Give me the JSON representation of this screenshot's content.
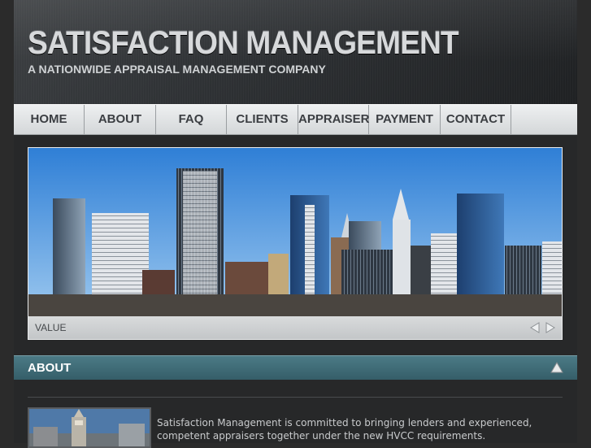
{
  "header": {
    "title": "SATISFACTION MANAGEMENT",
    "tagline": "A NATIONWIDE APPRAISAL MANAGEMENT COMPANY"
  },
  "nav": {
    "items": [
      {
        "label": "HOME"
      },
      {
        "label": "ABOUT"
      },
      {
        "label": "FAQ"
      },
      {
        "label": "CLIENTS"
      },
      {
        "label": "APPRAISER"
      },
      {
        "label": "PAYMENT"
      },
      {
        "label": "CONTACT"
      }
    ]
  },
  "slider": {
    "caption": "VALUE",
    "prev_icon": "triangle-left-icon",
    "next_icon": "triangle-right-icon"
  },
  "about_section": {
    "title": "ABOUT",
    "toggle_icon": "triangle-up-icon",
    "text": "Satisfaction Management is committed to bringing lenders and experienced, competent appraisers together under the new HVCC requirements."
  },
  "colors": {
    "background": "#2b2b2b",
    "section_bar": "#416c77",
    "nav": "#e2e5e6",
    "text_light": "#c9cbcd"
  }
}
